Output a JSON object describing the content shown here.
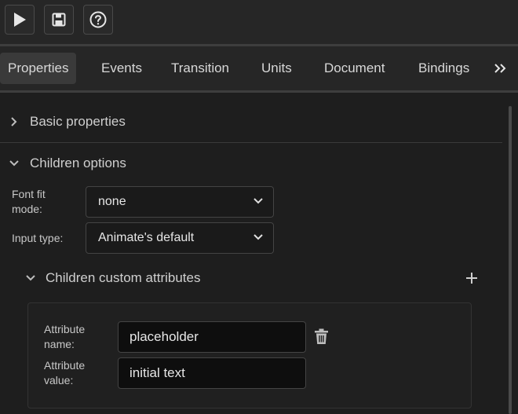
{
  "tabs": [
    "Properties",
    "Events",
    "Transition",
    "Units",
    "Document",
    "Bindings"
  ],
  "sections": {
    "basic": "Basic properties",
    "children": "Children options",
    "custom_attrs": "Children custom attributes"
  },
  "fields": {
    "font_fit_label": "Font fit mode:",
    "font_fit_value": "none",
    "input_type_label": "Input type:",
    "input_type_value": "Animate's default"
  },
  "attributes": {
    "name_label": "Attribute name:",
    "name_value": "placeholder",
    "value_label": "Attribute value:",
    "value_value": "initial text"
  },
  "icons": [
    "play-icon",
    "save-icon",
    "help-icon",
    "more-tabs-icon",
    "chevron-right-icon",
    "chevron-down-icon",
    "plus-icon",
    "trash-icon"
  ],
  "colors": {
    "background": "#1e1e1e",
    "active_tab": "#3a3a3a",
    "text": "#d4d4d4"
  }
}
